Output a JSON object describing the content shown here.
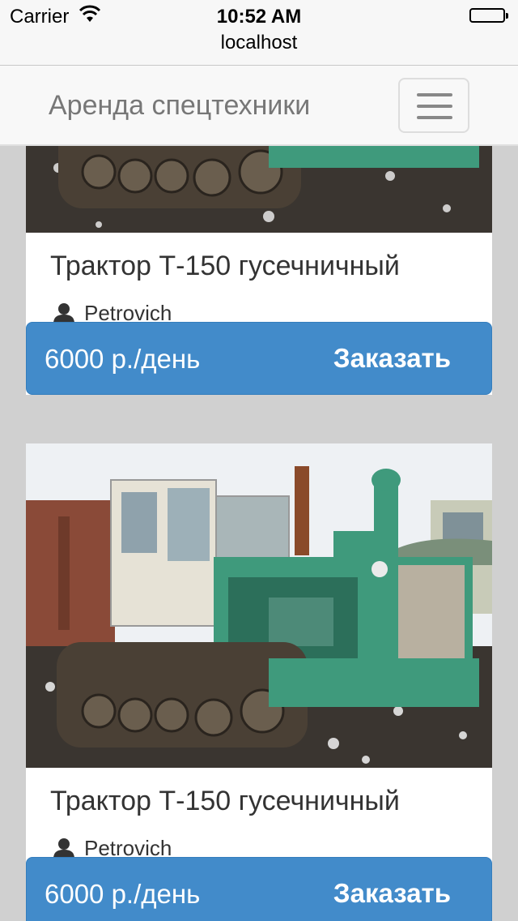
{
  "status_bar": {
    "carrier": "Carrier",
    "time": "10:52 AM"
  },
  "browser": {
    "url": "localhost"
  },
  "navbar": {
    "brand": "Аренда спецтехники"
  },
  "listings": [
    {
      "title": "Трактор Т-150 гусечничный",
      "owner": "Petrovich",
      "price": "6000 р./день",
      "order_label": "Заказать"
    },
    {
      "title": "Трактор Т-150 гусечничный",
      "owner": "Petrovich",
      "price": "6000 р./день",
      "order_label": "Заказать"
    }
  ],
  "colors": {
    "primary": "#428bca",
    "navbar_bg": "#f8f8f8",
    "page_bg": "#d0d0d0"
  },
  "icons": {
    "owner": "user-icon",
    "menu": "hamburger-menu-icon",
    "signal": "wifi-icon",
    "battery": "battery-icon"
  }
}
